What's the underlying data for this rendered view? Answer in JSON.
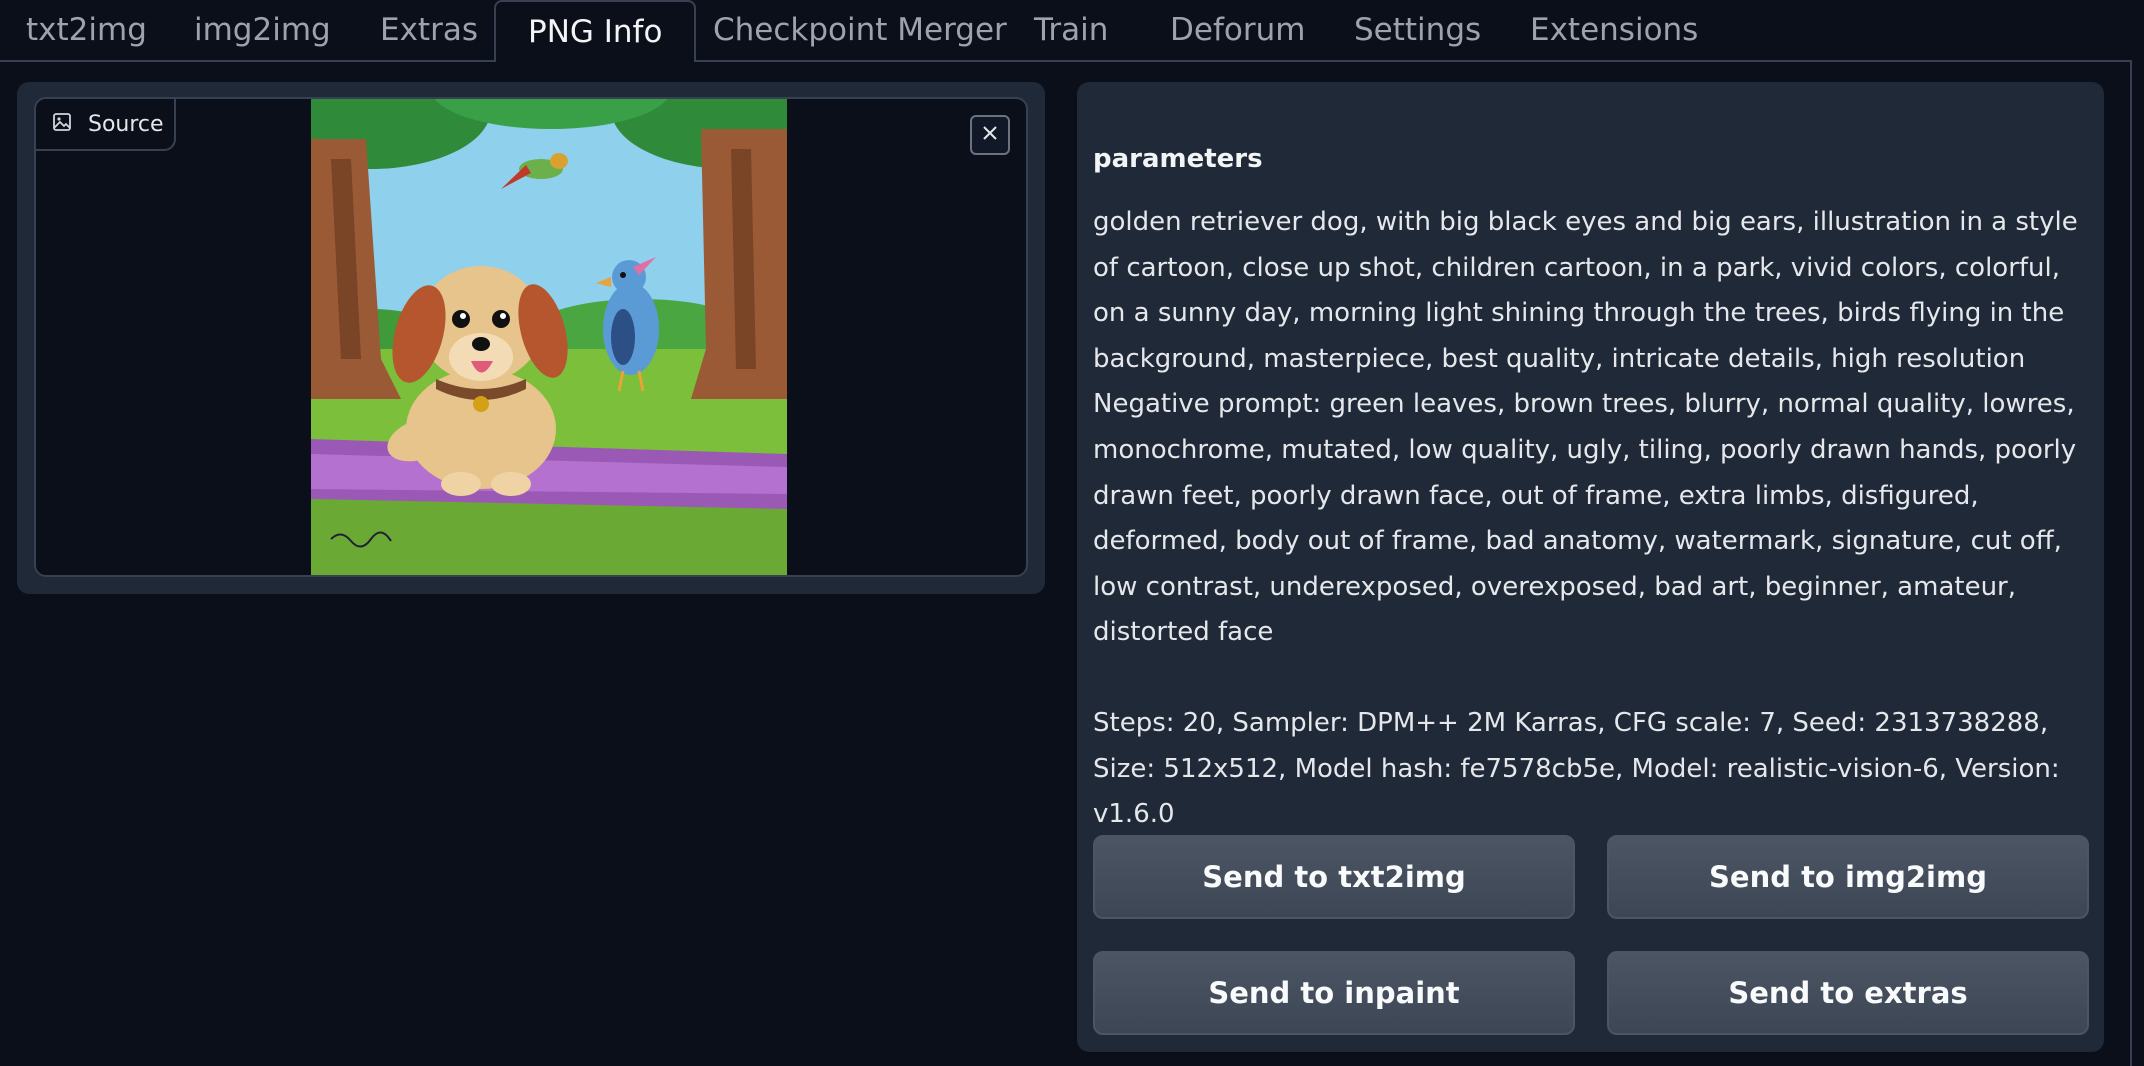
{
  "tabs": [
    {
      "label": "txt2img"
    },
    {
      "label": "img2img"
    },
    {
      "label": "Extras"
    },
    {
      "label": "PNG Info"
    },
    {
      "label": "Checkpoint Merger"
    },
    {
      "label": "Train"
    },
    {
      "label": "Deforum"
    },
    {
      "label": "Settings"
    },
    {
      "label": "Extensions"
    }
  ],
  "active_tab": "PNG Info",
  "image_panel": {
    "label": "Source",
    "label_icon": "image-icon",
    "close_icon": "close-icon",
    "image_description": "cartoon golden retriever puppy sitting on purple path in park with blue bird and flying bird"
  },
  "info": {
    "heading": "parameters",
    "prompt": "golden retriever dog, with big black eyes and big ears, illustration in a style of cartoon, close up shot, children cartoon, in a park, vivid colors, colorful, on a sunny day, morning light shining through the trees, birds flying in the background, masterpiece, best quality, intricate details, high resolution",
    "negative_prompt": "Negative prompt: green leaves, brown trees, blurry, normal quality, lowres, monochrome, mutated, low quality, ugly, tiling, poorly drawn hands, poorly drawn feet, poorly drawn face, out of frame, extra limbs, disfigured, deformed, body out of frame, bad anatomy, watermark, signature, cut off, low contrast, underexposed, overexposed, bad art, beginner, amateur, distorted face",
    "generation_info": "Steps: 20, Sampler: DPM++ 2M Karras, CFG scale: 7, Seed: 2313738288, Size: 512x512, Model hash: fe7578cb5e, Model: realistic-vision-6, Version: v1.6.0"
  },
  "buttons": {
    "send_txt2img": "Send to txt2img",
    "send_img2img": "Send to img2img",
    "send_inpaint": "Send to inpaint",
    "send_extras": "Send to extras"
  },
  "colors": {
    "background": "#0b0f19",
    "panel": "#1f2937",
    "border": "#374151",
    "button": "#4b5563"
  }
}
